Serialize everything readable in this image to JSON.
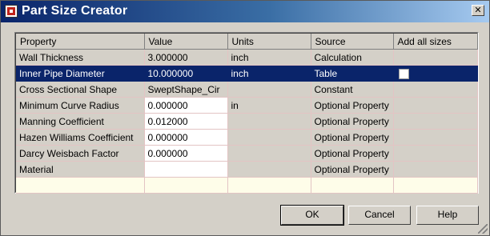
{
  "window": {
    "title": "Part Size Creator",
    "close_glyph": "✕"
  },
  "table": {
    "headers": [
      "Property",
      "Value",
      "Units",
      "Source",
      "Add all sizes"
    ],
    "rows": [
      {
        "property": "Wall Thickness",
        "value": "3.000000",
        "units": "inch",
        "source": "Calculation"
      },
      {
        "property": "Inner Pipe Diameter",
        "value": "10.000000",
        "units": "inch",
        "source": "Table",
        "add_all_sizes": false,
        "selected": true
      },
      {
        "property": "Cross Sectional Shape",
        "value": "SweptShape_Cir",
        "units": "",
        "source": "Constant"
      },
      {
        "property": "Minimum Curve Radius",
        "value": "0.000000",
        "units": "in",
        "source": "Optional Property"
      },
      {
        "property": "Manning Coefficient",
        "value": "0.012000",
        "units": "",
        "source": "Optional Property"
      },
      {
        "property": "Hazen Williams Coefficient",
        "value": "0.000000",
        "units": "",
        "source": "Optional Property"
      },
      {
        "property": "Darcy Weisbach Factor",
        "value": "0.000000",
        "units": "",
        "source": "Optional Property"
      },
      {
        "property": "Material",
        "value": "",
        "units": "",
        "source": "Optional Property"
      }
    ]
  },
  "buttons": {
    "ok": "OK",
    "cancel": "Cancel",
    "help": "Help"
  },
  "icons": {
    "app": "part-builder-icon",
    "close": "close-icon",
    "resize": "resize-grip-icon"
  },
  "colors": {
    "title_bar": "#0a246a",
    "selection": "#0a246a",
    "grid_lines": "#e3c4c4",
    "new_row": "#fefde9"
  }
}
